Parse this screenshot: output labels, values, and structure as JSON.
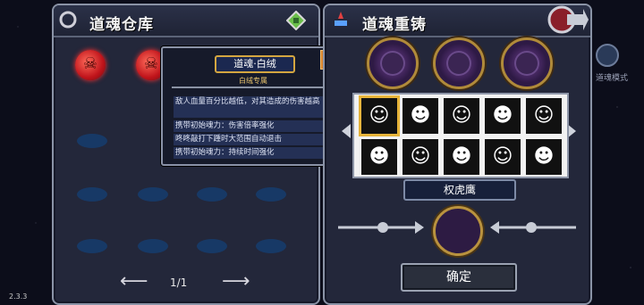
{
  "left_panel": {
    "title": "道魂仓库",
    "pagination": {
      "text": "1/1",
      "prev_icon": "arrow-left-icon",
      "next_icon": "arrow-right-icon"
    }
  },
  "tooltip": {
    "name": "道魂·白绒",
    "subtitle": "白绒专属",
    "lines": [
      "敌人血量百分比越低，对其造成的伤害越高",
      "携带初始魂力：伤害倍率强化",
      "咚咚敲打下踵时大范围自动退击",
      "携带初始魂力：持续时间强化"
    ]
  },
  "right_panel": {
    "title": "道魂重铸",
    "selected_name": "权虎鹰",
    "confirm_label": "确定"
  },
  "corner": {
    "label": "道魂模式"
  },
  "version": "2.3.3",
  "colors": {
    "panel": "#23273a",
    "slot": "#173a68",
    "gold": "#b08a3a",
    "highlight": "#e7b43a"
  }
}
